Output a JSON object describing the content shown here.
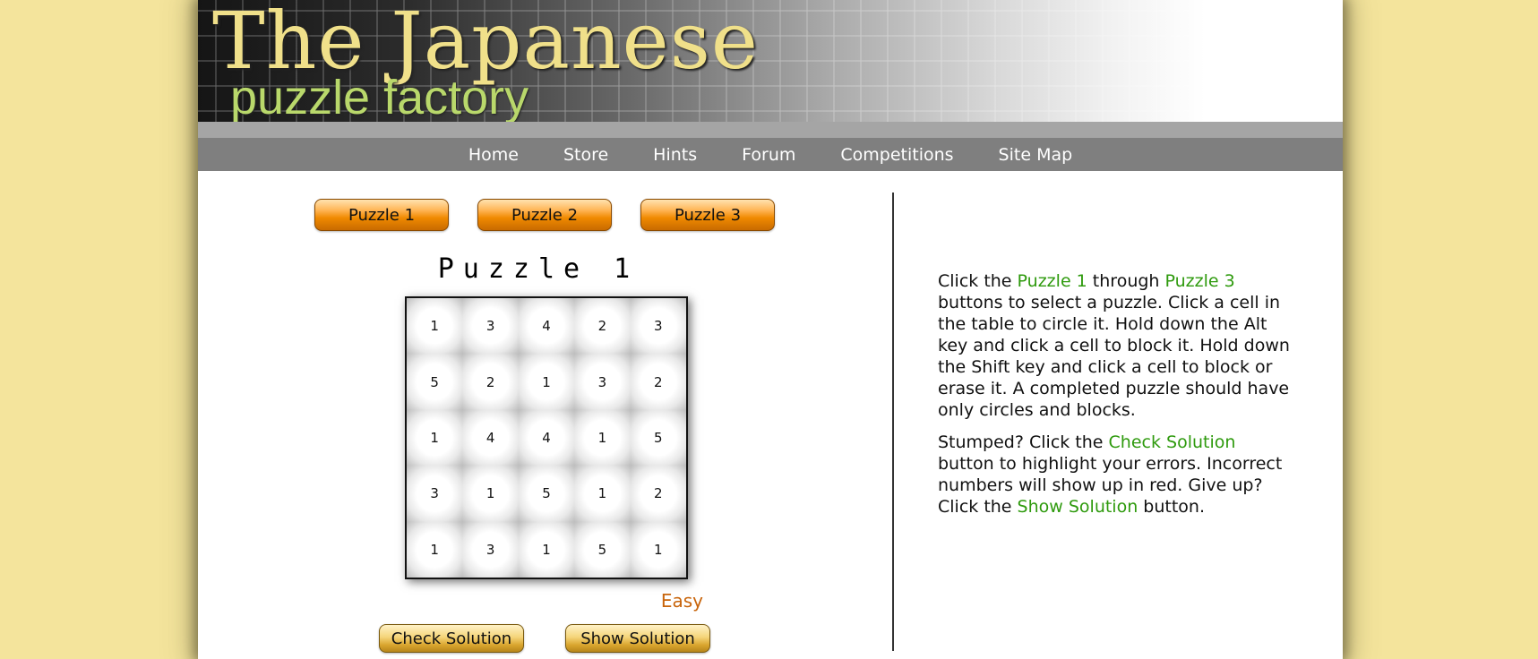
{
  "banner": {
    "title_main": "The Japanese",
    "title_sub": "puzzle factory"
  },
  "nav": {
    "items": [
      "Home",
      "Store",
      "Hints",
      "Forum",
      "Competitions",
      "Site Map"
    ]
  },
  "puzzle_buttons": [
    "Puzzle 1",
    "Puzzle 2",
    "Puzzle 3"
  ],
  "puzzle": {
    "title": "Puzzle 1",
    "difficulty": "Easy",
    "grid": [
      [
        "1",
        "3",
        "4",
        "2",
        "3"
      ],
      [
        "5",
        "2",
        "1",
        "3",
        "2"
      ],
      [
        "1",
        "4",
        "4",
        "1",
        "5"
      ],
      [
        "3",
        "1",
        "5",
        "1",
        "2"
      ],
      [
        "1",
        "3",
        "1",
        "5",
        "1"
      ]
    ]
  },
  "actions": {
    "check_label": "Check Solution",
    "show_label": "Show Solution"
  },
  "instructions": {
    "p1": {
      "t1": "Click the ",
      "h1": "Puzzle 1",
      "t2": " through ",
      "h2": "Puzzle 3",
      "t3": " buttons to select a puzzle. Click a cell in the table to circle it. Hold down the Alt key and click a cell to block it. Hold down the Shift key and click a cell to block or erase it. A completed puzzle should have only circles and blocks."
    },
    "p2": {
      "t1": "Stumped? Click the ",
      "h1": "Check Solution",
      "t2": " button to highlight your errors. Incorrect numbers will show up in red. Give up? Click the ",
      "h2": "Show Solution",
      "t3": " button."
    }
  },
  "colors": {
    "background": "#f4e49c",
    "nav": "#7f7f7f",
    "highlight": "#2e9a0d",
    "difficulty": "#c8640a"
  }
}
